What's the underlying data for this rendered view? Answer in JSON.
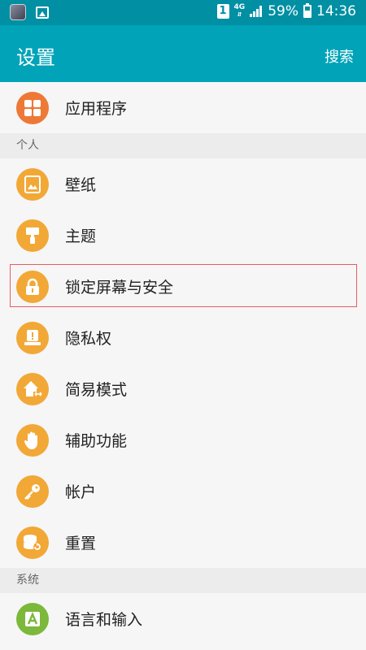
{
  "status_bar": {
    "sim_label": "1",
    "network": "4G",
    "battery": "59%",
    "battery_level": 0.59,
    "time": "14:36"
  },
  "app_bar": {
    "title": "设置",
    "search": "搜索"
  },
  "top_item": {
    "label": "应用程序",
    "icon": "apps-grid-icon",
    "color": "#ee7836"
  },
  "sections": [
    {
      "header": "个人",
      "items": [
        {
          "label": "壁纸",
          "icon": "wallpaper-icon",
          "color": "#f2a836"
        },
        {
          "label": "主题",
          "icon": "theme-brush-icon",
          "color": "#f2a836"
        },
        {
          "label": "锁定屏幕与安全",
          "icon": "lock-icon",
          "color": "#f2a836"
        },
        {
          "label": "隐私权",
          "icon": "privacy-alert-icon",
          "color": "#f2a836"
        },
        {
          "label": "简易模式",
          "icon": "easy-mode-home-icon",
          "color": "#f2a836"
        },
        {
          "label": "辅助功能",
          "icon": "accessibility-hand-icon",
          "color": "#f2a836"
        },
        {
          "label": "帐户",
          "icon": "key-icon",
          "color": "#f2a836"
        },
        {
          "label": "重置",
          "icon": "reset-database-icon",
          "color": "#f2a836"
        }
      ]
    },
    {
      "header": "系统",
      "items": [
        {
          "label": "语言和输入",
          "icon": "language-input-icon",
          "color": "#7cb83a"
        }
      ]
    }
  ]
}
